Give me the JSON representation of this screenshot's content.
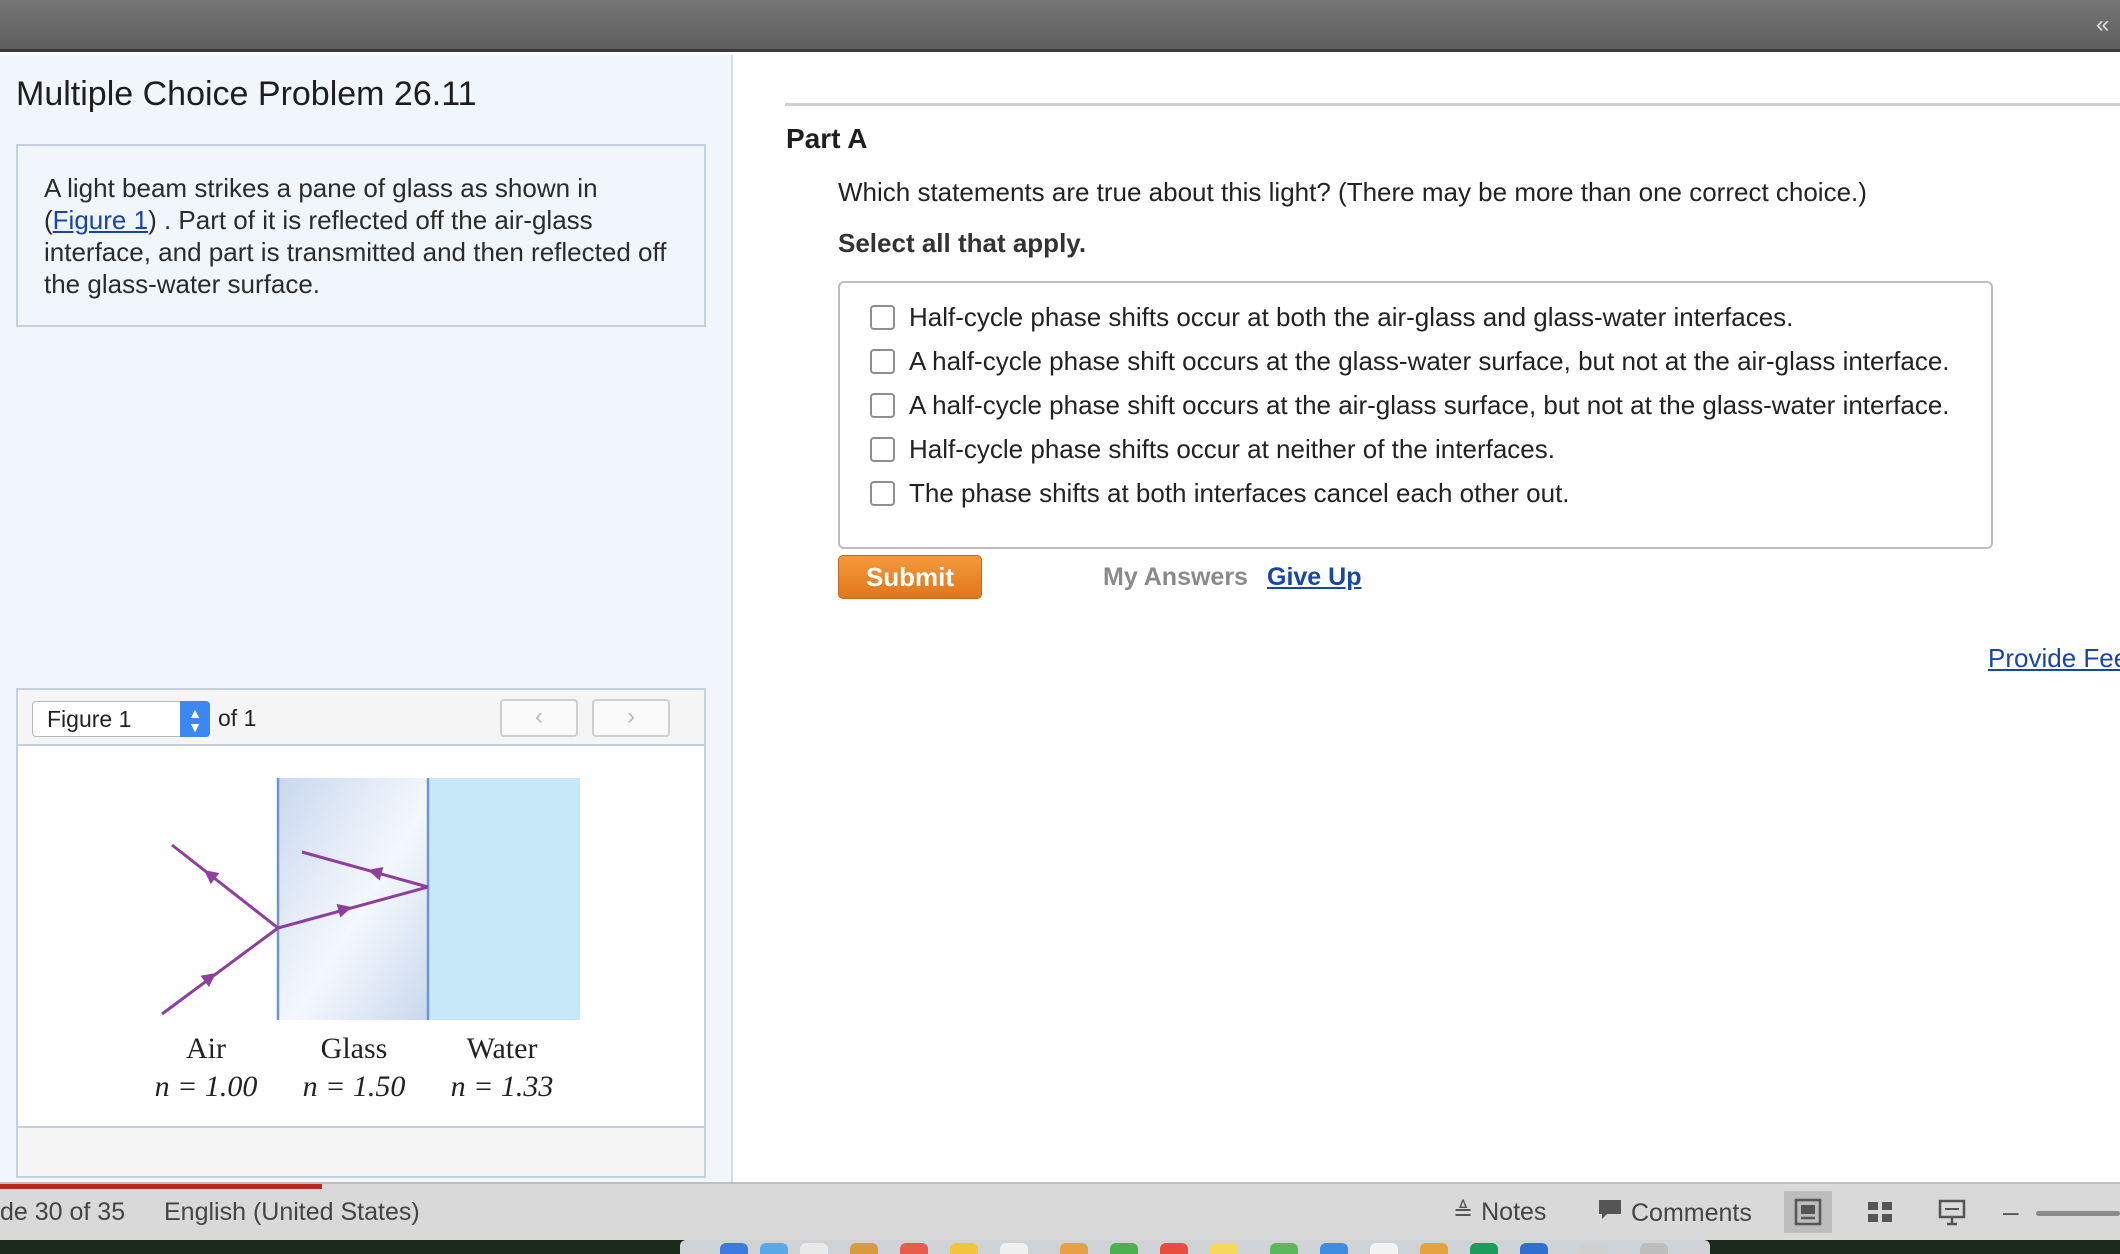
{
  "problem": {
    "title": "Multiple Choice Problem 26.11",
    "intro_before_link": "A light beam strikes a pane of glass as shown in (",
    "intro_link": "Figure 1",
    "intro_after_link": ") . Part of it is reflected off the air-glass interface, and part is transmitted and then reflected off the glass-water surface."
  },
  "figure_panel": {
    "select_value": "Figure 1",
    "of_label": "of 1",
    "prev_glyph": "‹",
    "next_glyph": "›",
    "media": [
      {
        "name": "Air",
        "index": "n = 1.00"
      },
      {
        "name": "Glass",
        "index": "n = 1.50"
      },
      {
        "name": "Water",
        "index": "n = 1.33"
      }
    ],
    "colors": {
      "glass": "#dfe9f6",
      "water": "#c7e8f8",
      "ray": "#8e3e9f",
      "interface": "#6f95cf"
    }
  },
  "part": {
    "title": "Part A",
    "question": "Which statements are true about this light? (There may be more than one correct choice.)",
    "instruction": "Select all that apply.",
    "choices": [
      "Half-cycle phase shifts occur at both the air-glass and glass-water interfaces.",
      "A half-cycle phase shift occurs at the glass-water surface, but not at the air-glass interface.",
      "A half-cycle phase shift occurs at the air-glass surface, but not at the glass-water interface.",
      "Half-cycle phase shifts occur at neither of the interfaces.",
      "The phase shifts at both interfaces cancel each other out."
    ],
    "submit_label": "Submit",
    "my_answers_label": "My Answers",
    "give_up_label": "Give Up",
    "feedback_label": "Provide Fee"
  },
  "statusbar": {
    "slide": "de 30 of 35",
    "language": "English (United States)",
    "notes_label": "Notes",
    "comments_label": "Comments"
  },
  "topbar": {
    "collapse_glyph": "«"
  },
  "colors": {
    "accent_orange": "#e9812a",
    "link_blue": "#1845a8",
    "panel_bg": "#f1f6fd"
  }
}
